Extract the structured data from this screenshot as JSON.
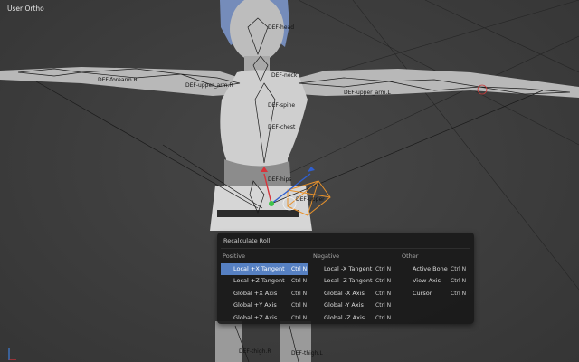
{
  "viewport": {
    "label": "User Ortho",
    "bone_labels": [
      "DEF-head",
      "DEF-neck",
      "DEF-chest",
      "DEF-hips",
      "DEF-spine",
      "DEF-upper_arm.R",
      "DEF-upper_arm.L",
      "DEF-forearm.R",
      "DEF-thigh.R",
      "DEF-thigh.L",
      "DEF-upper"
    ]
  },
  "menu": {
    "title": "Recalculate Roll",
    "columns": {
      "positive": {
        "header": "Positive",
        "items": [
          {
            "label": "Local +X Tangent",
            "shortcut": "Ctrl N",
            "active": true
          },
          {
            "label": "Local +Z Tangent",
            "shortcut": "Ctrl N"
          },
          {
            "label": "Global +X Axis",
            "shortcut": "Ctrl N"
          },
          {
            "label": "Global +Y Axis",
            "shortcut": "Ctrl N"
          },
          {
            "label": "Global +Z Axis",
            "shortcut": "Ctrl N"
          }
        ]
      },
      "negative": {
        "header": "Negative",
        "items": [
          {
            "label": "Local -X Tangent",
            "shortcut": "Ctrl N"
          },
          {
            "label": "Local -Z Tangent",
            "shortcut": "Ctrl N"
          },
          {
            "label": "Global -X Axis",
            "shortcut": "Ctrl N"
          },
          {
            "label": "Global -Y Axis",
            "shortcut": "Ctrl N"
          },
          {
            "label": "Global -Z Axis",
            "shortcut": "Ctrl N"
          }
        ]
      },
      "other": {
        "header": "Other",
        "items": [
          {
            "label": "Active Bone",
            "shortcut": "Ctrl N"
          },
          {
            "label": "View Axis",
            "shortcut": "Ctrl N"
          },
          {
            "label": "Cursor",
            "shortcut": "Ctrl N"
          }
        ]
      }
    }
  },
  "colors": {
    "highlight": "#5680c2",
    "selected_bone": "#e8922c",
    "hair": "#7b95c8"
  }
}
